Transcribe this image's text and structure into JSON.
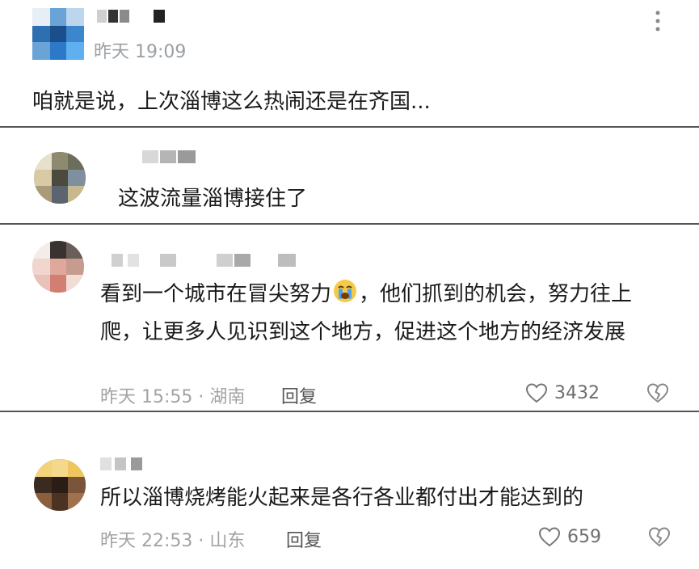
{
  "post": {
    "time": "昨天 19:09",
    "content": "咱就是说，上次淄博这么热闹还是在齐国..."
  },
  "comments": [
    {
      "content": "这波流量淄博接住了"
    },
    {
      "content_before_emoji": "看到一个城市在冒尖努力",
      "content_after_emoji": "，他们抓到的机会，努力往上爬，让更多人见识到这个地方，促进这个地方的经济发展",
      "emoji": "crying-face-icon",
      "meta": "昨天 15:55 · 湖南",
      "reply_label": "回复",
      "likes": "3432"
    },
    {
      "content": "所以淄博烧烤能火起来是各行各业都付出才能达到的",
      "meta": "昨天 22:53 · 山东",
      "reply_label": "回复",
      "likes": "659"
    }
  ],
  "colors": {
    "divider": "#555555",
    "muted": "#9aa0a6",
    "text": "#1a1a1a"
  }
}
